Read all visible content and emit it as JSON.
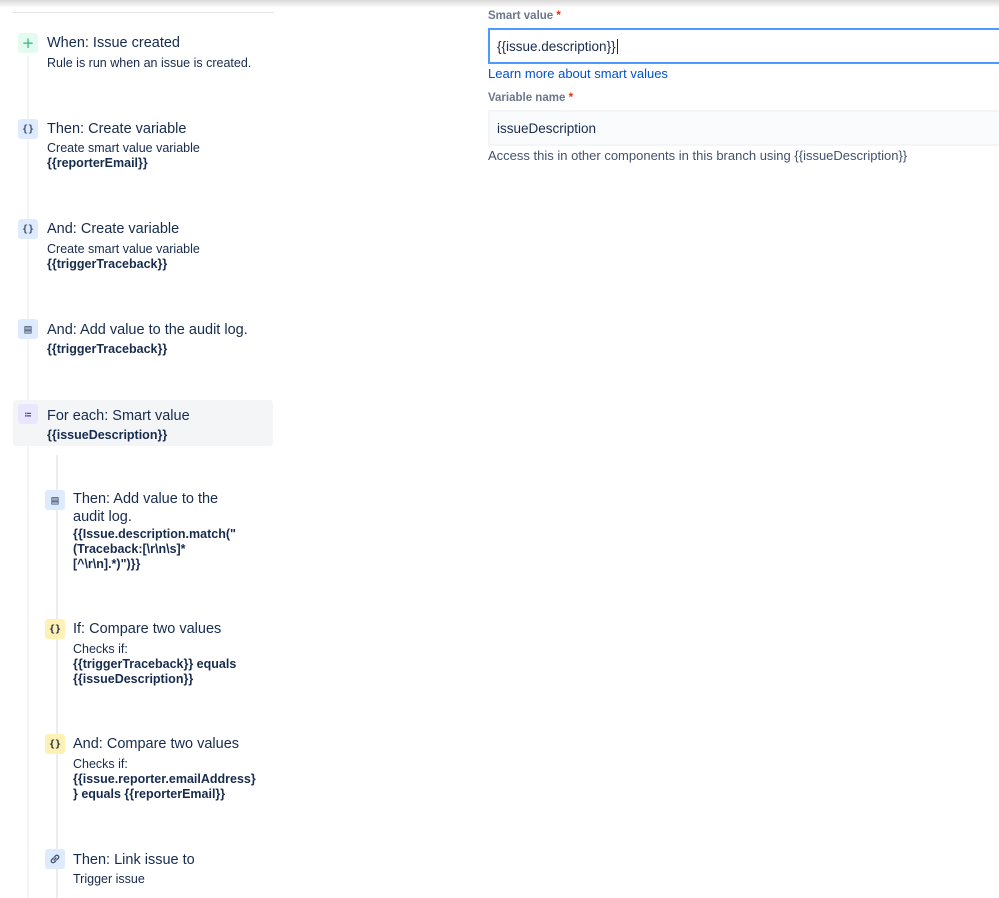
{
  "steps": [
    {
      "icon": "plus-icon",
      "glyph": "+",
      "title": "When: Issue created",
      "lines": [
        "Rule is run when an issue is created."
      ],
      "bold": []
    },
    {
      "icon": "braces-icon",
      "glyph": "{}",
      "title": "Then: Create variable",
      "lines": [
        "Create smart value variable"
      ],
      "bold": [
        "{{reporterEmail}}"
      ]
    },
    {
      "icon": "braces-icon",
      "glyph": "{}",
      "title": "And: Create variable",
      "lines": [
        "Create smart value variable"
      ],
      "bold": [
        "{{triggerTraceback}}"
      ]
    },
    {
      "icon": "audit-log-icon",
      "glyph": "▤",
      "title": "And: Add value to the audit log.",
      "lines": [],
      "bold": [
        "{{triggerTraceback}}"
      ]
    },
    {
      "icon": "list-icon",
      "glyph": "≔",
      "title": "For each: Smart value",
      "lines": [],
      "bold": [
        "{{issueDescription}}"
      ]
    },
    {
      "icon": "audit-log-icon",
      "glyph": "▤",
      "title": [
        "Then: Add value to the",
        "audit log."
      ],
      "lines": [],
      "bold": [
        "{{Issue.description.match(\"",
        "(Traceback:[\\r\\n\\s]*",
        "[^\\r\\n].*)\")}}"
      ]
    },
    {
      "icon": "braces-icon",
      "glyph": "{}",
      "title": "If: Compare two values",
      "lines": [
        "Checks if:"
      ],
      "bold": [
        "{{triggerTraceback}} equals",
        "{{issueDescription}}"
      ]
    },
    {
      "icon": "braces-icon",
      "glyph": "{}",
      "title": "And: Compare two values",
      "lines": [
        "Checks if:"
      ],
      "bold": [
        "{{issue.reporter.emailAddress}",
        "} equals {{reporterEmail}}"
      ]
    },
    {
      "icon": "link-icon",
      "glyph": "🔗",
      "title": "Then: Link issue to",
      "lines": [
        "Trigger issue"
      ],
      "bold": []
    }
  ],
  "panel": {
    "smart_value_label": "Smart value",
    "required_mark": "*",
    "smart_value": "{{issue.description}}",
    "learn_more": "Learn more about smart values",
    "variable_name_label": "Variable name",
    "variable_name": "issueDescription",
    "help_text": "Access this in other components in this branch using {{issueDescription}}"
  },
  "colors": {
    "accent": "#0052cc",
    "focus_border": "#4c9aff",
    "required": "#de350b",
    "trigger_green": "#36b37e",
    "condition_yellow": "#fff0b3"
  }
}
